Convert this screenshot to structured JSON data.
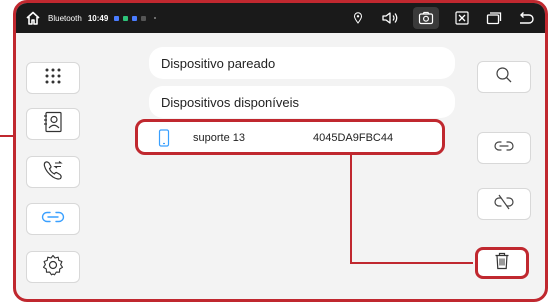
{
  "statusbar": {
    "app_title": "Bluetooth",
    "time": "10:49",
    "notif_colors": [
      "#4a7cff",
      "#2ec47a",
      "#4a7cff",
      "#555555"
    ],
    "icons": [
      "home-icon",
      "location-icon",
      "volume-icon",
      "screenshot-icon",
      "close-window-icon",
      "window-switch-icon",
      "back-icon"
    ]
  },
  "sidebar": {
    "items": [
      {
        "icon": "dialpad-icon"
      },
      {
        "icon": "contacts-icon"
      },
      {
        "icon": "call-log-icon"
      },
      {
        "icon": "bluetooth-link-icon",
        "active": true
      },
      {
        "icon": "settings-icon"
      }
    ]
  },
  "lists": {
    "paired_header": "Dispositivo pareado",
    "available_header": "Dispositivos disponíveis"
  },
  "device": {
    "name": "suporte 13",
    "mac": "4045DA9FBC44"
  },
  "actions": {
    "icons": [
      "search-icon",
      "connect-icon",
      "disconnect-icon",
      "delete-icon"
    ]
  },
  "colors": {
    "accent": "#c0282f",
    "active_icon": "#3aa0ff",
    "statusbar_bg": "#1a1a1a"
  }
}
